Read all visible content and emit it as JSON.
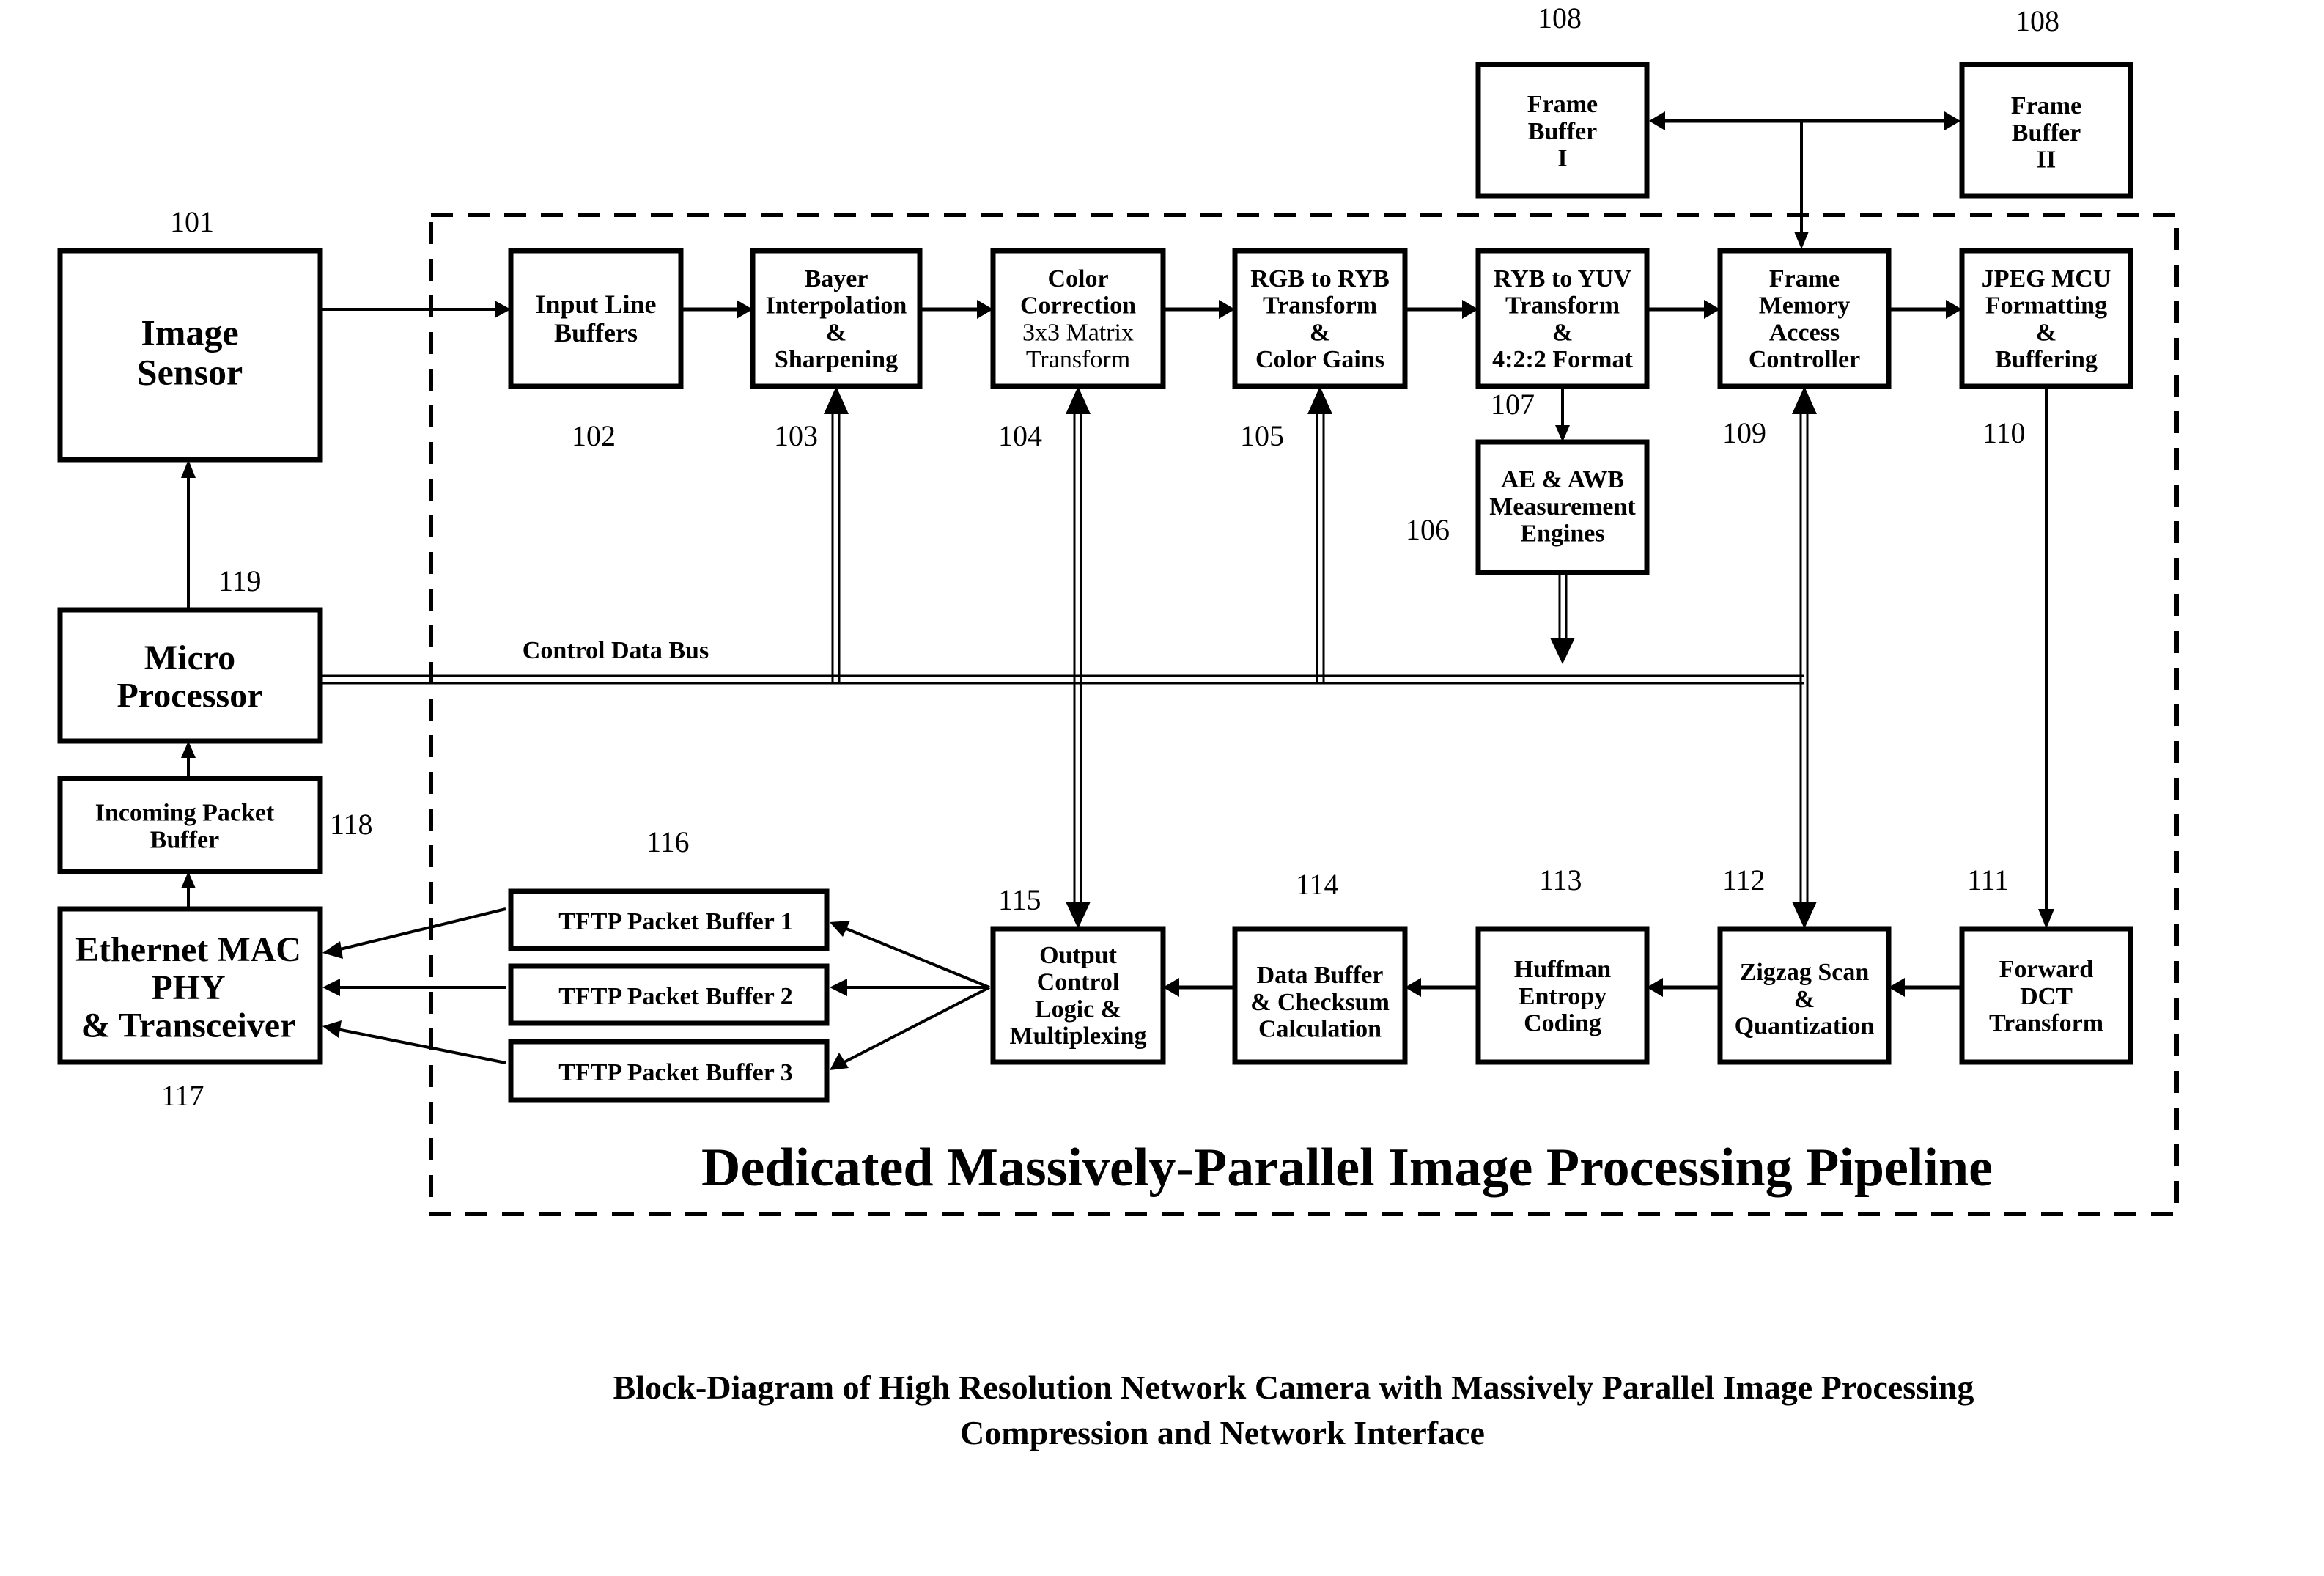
{
  "diagram": {
    "pipeline_title": "Dedicated Massively-Parallel Image Processing Pipeline",
    "caption_line1": "Block-Diagram of High Resolution Network Camera with Massively Parallel Image Processing",
    "caption_line2": "Compression and Network Interface",
    "bus_label": "Control Data Bus",
    "blocks": {
      "image_sensor": {
        "id": "101",
        "lines": [
          "Image",
          "Sensor"
        ]
      },
      "input_line_buffers": {
        "id": "102",
        "lines": [
          "Input Line",
          "Buffers"
        ]
      },
      "bayer": {
        "id": "103",
        "lines": [
          "Bayer",
          "Interpolation",
          "&",
          "Sharpening"
        ]
      },
      "color_correction": {
        "id": "104",
        "lines": [
          "Color",
          "Correction",
          "3x3 Matrix",
          "Transform"
        ]
      },
      "rgb_ryb": {
        "id": "105",
        "lines": [
          "RGB to RYB",
          "Transform",
          "&",
          "Color Gains"
        ]
      },
      "ae_awb": {
        "id": "106",
        "lines": [
          "AE & AWB",
          "Measurement",
          "Engines"
        ]
      },
      "ryb_yuv": {
        "id": "107",
        "lines": [
          "RYB to YUV",
          "Transform",
          "&",
          "4:2:2 Format"
        ]
      },
      "frame_buffer_1": {
        "id": "108",
        "lines": [
          "Frame",
          "Buffer",
          "I"
        ]
      },
      "frame_buffer_2": {
        "id": "108",
        "lines": [
          "Frame",
          "Buffer",
          "II"
        ]
      },
      "frame_memory": {
        "id": "109",
        "lines": [
          "Frame",
          "Memory",
          "Access",
          "Controller"
        ]
      },
      "jpeg_mcu": {
        "id": "110",
        "lines": [
          "JPEG MCU",
          "Formatting",
          "&",
          "Buffering"
        ]
      },
      "dct": {
        "id": "111",
        "lines": [
          "Forward",
          "DCT",
          "Transform"
        ]
      },
      "zigzag": {
        "id": "112",
        "lines": [
          "Zigzag Scan",
          "&",
          "Quantization"
        ]
      },
      "huffman": {
        "id": "113",
        "lines": [
          "Huffman",
          "Entropy",
          "Coding"
        ]
      },
      "data_buffer": {
        "id": "114",
        "lines": [
          "Data Buffer",
          "& Checksum",
          "Calculation"
        ]
      },
      "output_control": {
        "id": "115",
        "lines": [
          "Output",
          "Control",
          "Logic &",
          "Multiplexing"
        ]
      },
      "tftp_group": {
        "id": "116"
      },
      "tftp_1": {
        "lines": [
          "TFTP Packet Buffer 1"
        ]
      },
      "tftp_2": {
        "lines": [
          "TFTP Packet Buffer 2"
        ]
      },
      "tftp_3": {
        "lines": [
          "TFTP Packet Buffer 3"
        ]
      },
      "ethernet": {
        "id": "117",
        "lines": [
          "Ethernet MAC",
          "PHY",
          "& Transceiver"
        ]
      },
      "incoming_buffer": {
        "id": "118",
        "lines": [
          "Incoming Packet",
          "Buffer"
        ]
      },
      "microprocessor": {
        "id": "119",
        "lines": [
          "Micro",
          "Processor"
        ]
      }
    }
  }
}
